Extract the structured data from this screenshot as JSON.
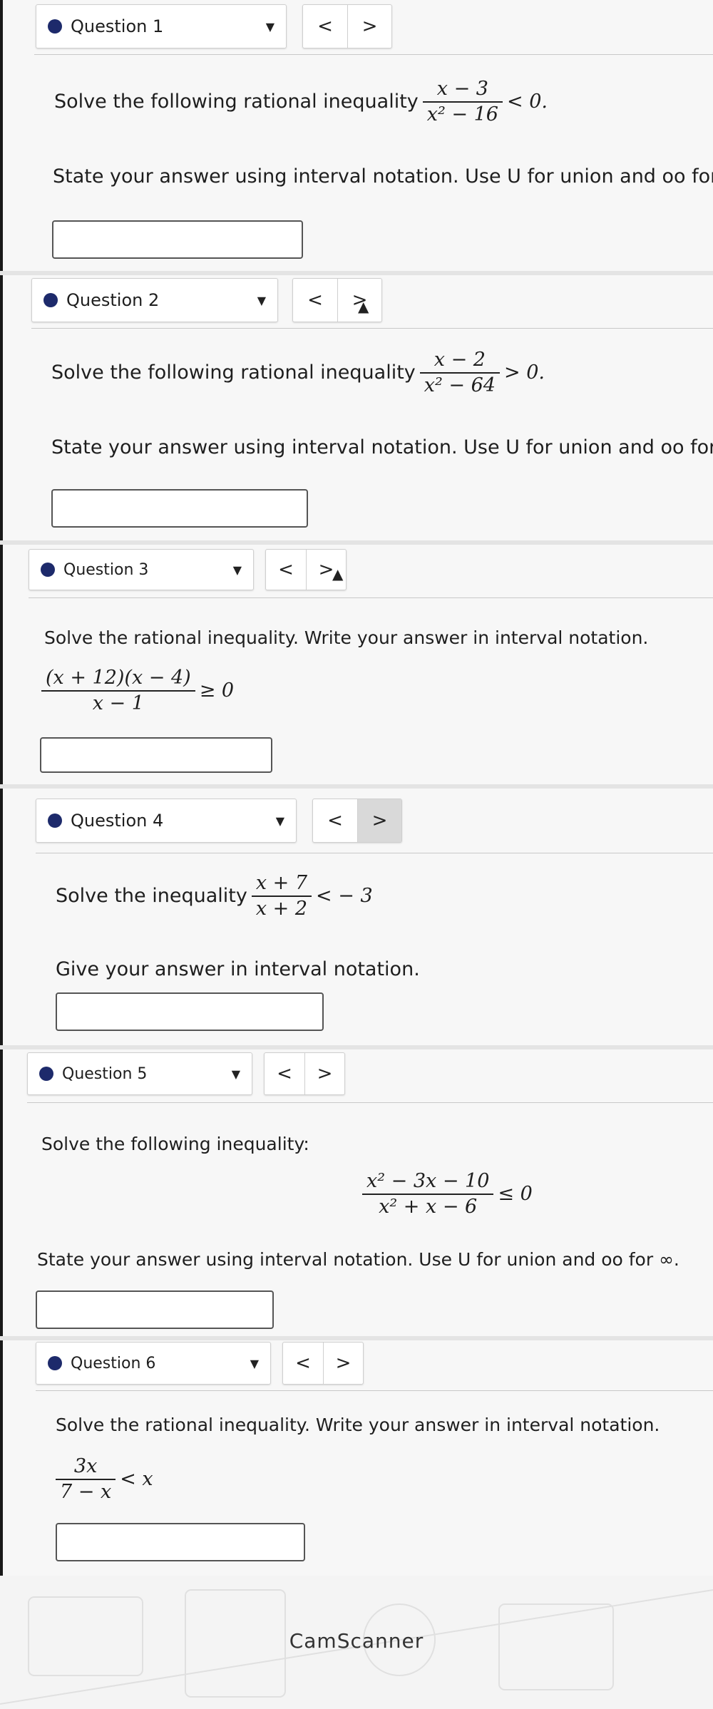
{
  "questions": [
    {
      "label": "Question 1",
      "prompt": "Solve the following rational inequality",
      "num": "x − 3",
      "den": "x² − 16",
      "rel": "< 0.",
      "instruction": "State your answer using interval notation. Use U for union and oo for ∞."
    },
    {
      "label": "Question 2",
      "prompt": "Solve the following rational inequality",
      "num": "x − 2",
      "den": "x² − 64",
      "rel": "> 0.",
      "instruction": "State your answer using interval notation. Use U for union and oo for ∞."
    },
    {
      "label": "Question 3",
      "prompt": "Solve the rational inequality. Write your answer in interval notation.",
      "num": "(x + 12)(x − 4)",
      "den": "x − 1",
      "rel": "≥ 0"
    },
    {
      "label": "Question 4",
      "prompt": "Solve the inequality",
      "num": "x + 7",
      "den": "x + 2",
      "rel": "< − 3",
      "instruction": "Give your answer in interval notation."
    },
    {
      "label": "Question 5",
      "prompt": "Solve the following inequality:",
      "num": "x² − 3x − 10",
      "den": "x² + x − 6",
      "rel": "≤ 0",
      "instruction": "State your answer using interval notation. Use U for union and oo for ∞."
    },
    {
      "label": "Question 6",
      "prompt": "Solve the rational inequality. Write your answer in interval notation.",
      "num": "3x",
      "den": "7 − x",
      "rel": "< x"
    }
  ],
  "nav": {
    "prev": "<",
    "next": ">",
    "caret": "▼"
  },
  "footer": {
    "brand": "CamScanner"
  },
  "colors": {
    "dot": "#1d2a6b",
    "active_nav": "#d9d9d9"
  }
}
